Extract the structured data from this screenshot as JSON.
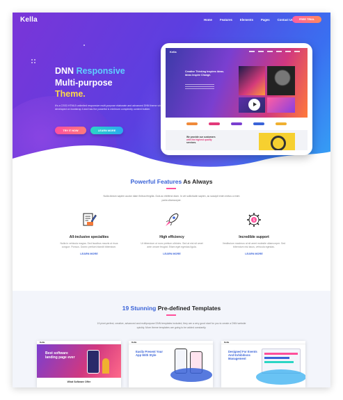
{
  "nav": {
    "logo": "Kella",
    "items": [
      {
        "label": "Home"
      },
      {
        "label": "Features"
      },
      {
        "label": "Elements"
      },
      {
        "label": "Pages"
      },
      {
        "label": "Contact Us"
      }
    ],
    "cta": "FREE TRIAL"
  },
  "hero": {
    "title_part1": "DNN ",
    "title_accent": "Responsive",
    "title_line2": "Multi-purpose",
    "title_line3": "Theme.",
    "description": "It's a CSS3 HTML5 unlimited responsive multi-purpose elaborate and advanced DNN theme which developed on bootstrap 4 and has the powerful & minimum complexity content builder.",
    "btn_primary": "TRY IT NOW",
    "btn_secondary": "LEARN MORE"
  },
  "mockup": {
    "logo": "Kella",
    "headline": "Creative Thinking Inspires Ideas. Ideas Inspire Change.",
    "bottom_text_1": "We provide our customers",
    "bottom_text_2": "with the highest quality",
    "bottom_text_3": "services."
  },
  "features": {
    "title_accent": "Powerful Features",
    "title_rest": " As Always",
    "description": "Nulla dictum sapien auctor diam finibus fringilla. Duis ac eleifend diam. In vel sollicitudin sapien, ac suscipit enim metus a enim porta ullamcorper.",
    "items": [
      {
        "title": "All-inclusive specialties",
        "text": "Nulla in vehicula magna. Sed faucibus mauris ut risus congue. Ponsus. Donec pretium blandit bibendum.",
        "link": "LEARN MORE",
        "icon": "document-pen-icon"
      },
      {
        "title": "High efficiency",
        "text": "Ut bibendum ut nunc pretium ultricies. Sed at nisl sit amet ante ornare feugiat. Etiam eget egestas ligula.",
        "link": "LEARN MORE",
        "icon": "rocket-icon"
      },
      {
        "title": "Incredible support",
        "text": "Vestibulum maximus at sit amet molestie ullamcorper. Sed bibendum nisi lacus, vehicula egestas.",
        "link": "LEARN MORE",
        "icon": "gear-money-icon"
      }
    ]
  },
  "templates": {
    "title_accent": "19 Stunning",
    "title_rest": " Pre-defined Templates",
    "description": "19 pixel-perfect, creative, advanced and multipurpose DNN templates included, they are a very good start for you to create a DNN website quickly. More theme templates are going to be added constantly.",
    "cards": [
      {
        "logo": "Kella",
        "headline": "Best software landing page ever",
        "footer": "What Software Offer"
      },
      {
        "logo": "Kella",
        "headline": "Easily Present Your App With Style",
        "footer": ""
      },
      {
        "logo": "Kella",
        "headline": "Designed For Events And Exhibitions Management",
        "footer": ""
      }
    ]
  },
  "colors": {
    "accent_blue": "#3a63d8",
    "accent_pink": "#ff4f9a",
    "hero_gradient_start": "#7a35d8",
    "hero_gradient_end": "#35a6f5"
  }
}
